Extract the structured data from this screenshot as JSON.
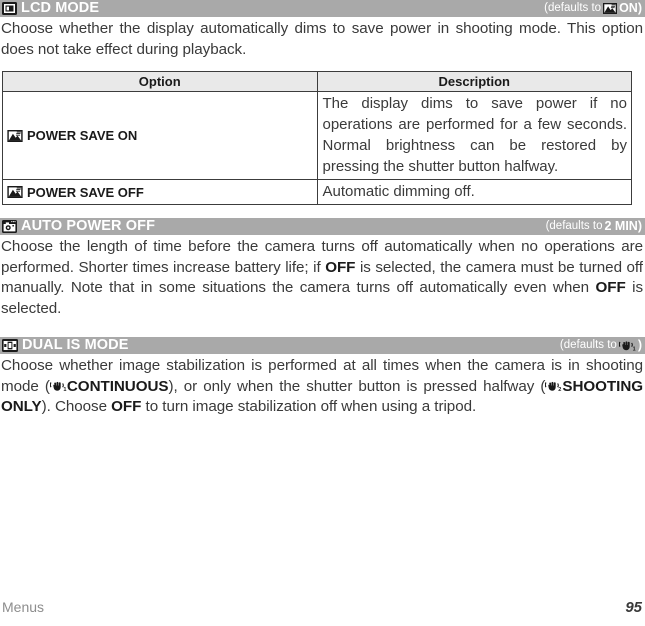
{
  "page": {
    "footer_left": "Menus",
    "footer_page": "95"
  },
  "sections": [
    {
      "icon": "lcd-screen-icon",
      "title": "LCD MODE",
      "defaults_label": "(defaults to",
      "defaults_icon": "power-save-on-icon",
      "defaults_value": "ON",
      "defaults_close": ")",
      "body": "Choose whether the display automatically dims to save power in shooting mode. This option does not take effect during playback."
    },
    {
      "icon": "auto-power-off-icon",
      "title": "AUTO POWER OFF",
      "defaults_label": "(defaults to",
      "defaults_value": "2 MIN",
      "defaults_close": ")",
      "body_parts": [
        "Choose the length of time before the camera turns off automatically when no operations are performed.  Shorter times increase battery life; if ",
        "OFF",
        " is selected, the camera must be turned off manually.  Note that in some situations the camera turns off automatically even when ",
        "OFF",
        " is selected."
      ]
    },
    {
      "icon": "dual-is-icon",
      "title": "DUAL IS MODE",
      "defaults_label": "(defaults to",
      "defaults_icon": "stabilizer-continuous-icon",
      "defaults_close": ")",
      "body_parts": [
        "Choose whether image stabilization is performed at all times when the camera is in shooting mode (",
        "CONTINUOUS",
        "), or only when the shutter button is pressed halfway (",
        "SHOOTING ONLY",
        ").  Choose ",
        "OFF",
        " to turn image stabilization off when using a tripod."
      ]
    }
  ],
  "table": {
    "headers": [
      "Option",
      "Description"
    ],
    "rows": [
      {
        "icon": "power-save-on-icon",
        "option": "POWER SAVE ON",
        "description": "The display dims to save power if no operations are performed for a few seconds. Normal brightness can be restored by pressing the shutter button halfway."
      },
      {
        "icon": "power-save-off-icon",
        "option": "POWER SAVE OFF",
        "description": "Automatic dimming off."
      }
    ]
  },
  "colors": {
    "section_bar": "#a9a9a9",
    "table_header": "#e9e9e9",
    "body_text": "#3a3a3a",
    "footer_muted": "#8d8d8d"
  }
}
